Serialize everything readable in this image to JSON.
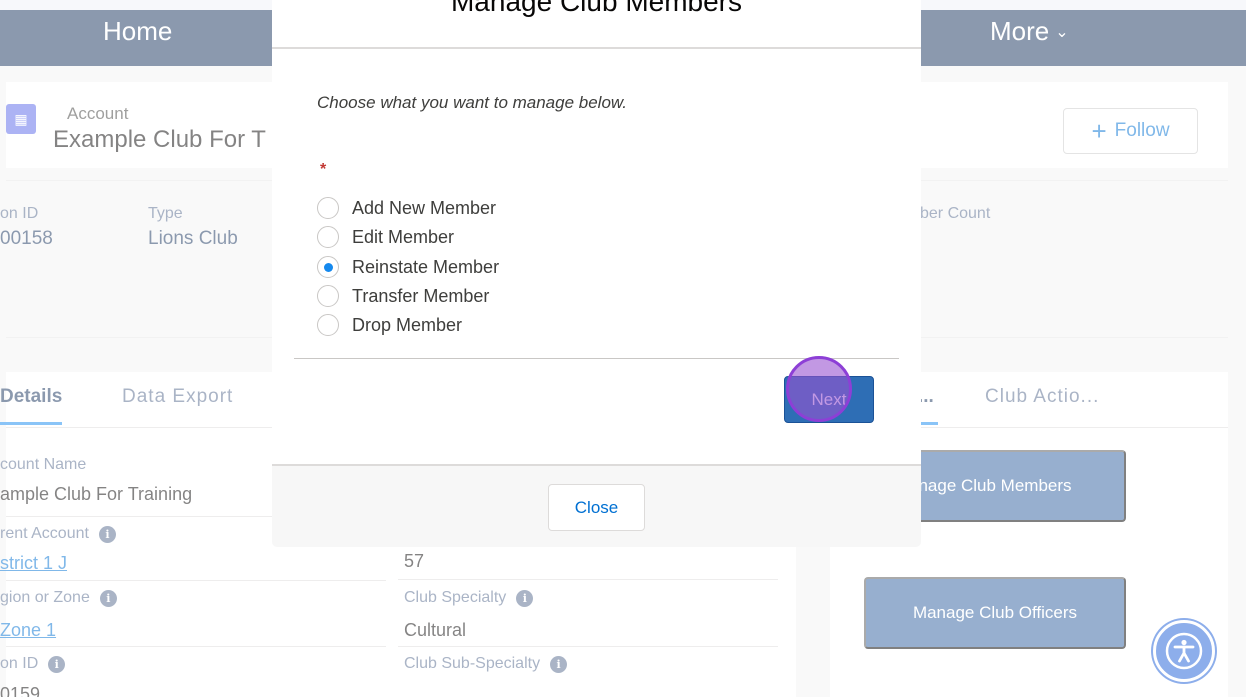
{
  "nav": {
    "home": "Home",
    "more": "More",
    "more_chevron": "⌄"
  },
  "account": {
    "object_label": "Account",
    "name": "Example Club For T",
    "follow_label": "Follow",
    "follow_icon": "+"
  },
  "highlights": {
    "col1_label": "on ID",
    "col1_value": "00158",
    "type_label": "Type",
    "type_value": "Lions Club",
    "member_count_label": "ber Count"
  },
  "details": {
    "tabs": [
      "Details",
      "Data Export"
    ],
    "account_name_label": "count Name",
    "account_name_value": "ample Club For Training",
    "parent_account_label": "rent Account",
    "parent_account_value": "strict 1 J",
    "region_zone_label": "gion or Zone",
    "region_zone_value": "Zone 1",
    "lion_id_label": "on ID",
    "lion_id_value": "0159",
    "number_value": "57",
    "club_specialty_label": "Club Specialty",
    "club_specialty_value": "Cultural",
    "club_sub_specialty_label": "Club Sub-Specialty"
  },
  "actions": {
    "tabs": [
      "...",
      "Club Actio..."
    ],
    "manage_members": "nage Club Members",
    "manage_officers": "Manage Club Officers"
  },
  "modal": {
    "title": "Manage Club Members",
    "prompt": "Choose what you want to manage below.",
    "required_marker": "*",
    "options": [
      {
        "label": "Add New Member",
        "checked": false
      },
      {
        "label": "Edit Member",
        "checked": false
      },
      {
        "label": "Reinstate Member",
        "checked": true
      },
      {
        "label": "Transfer Member",
        "checked": false
      },
      {
        "label": "Drop Member",
        "checked": false
      }
    ],
    "next_label": "Next",
    "close_label": "Close"
  },
  "colors": {
    "nav_bg": "#16325c",
    "brand_button": "#2e5f9e",
    "link": "#0070d2",
    "radio_checked": "#1589ee",
    "click_highlight": "#8d3fd6",
    "accessibility_button": "#1a5cd6"
  },
  "icons": {
    "account_icon": "account-building-icon",
    "info_icon": "info-icon",
    "accessibility_icon": "accessibility-icon"
  }
}
